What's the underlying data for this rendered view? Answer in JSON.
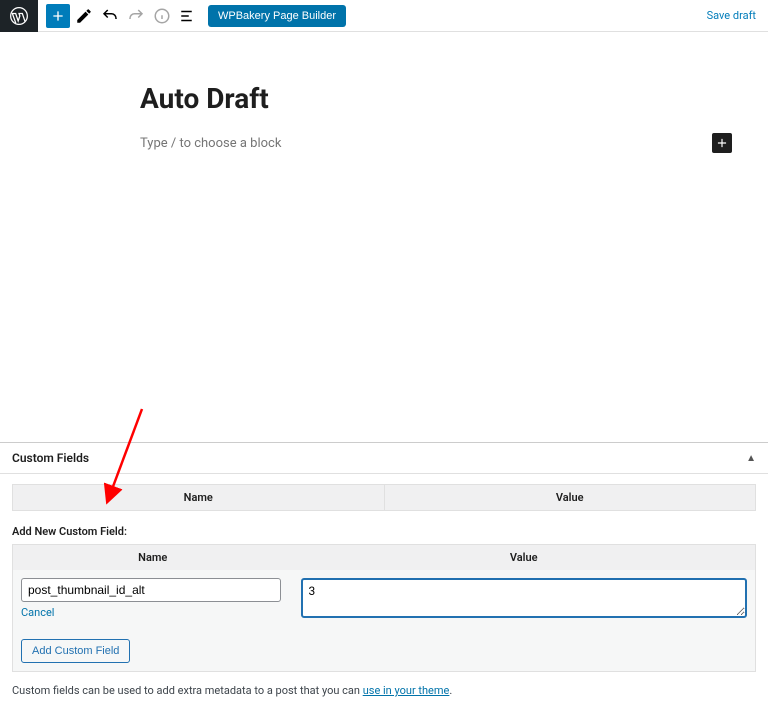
{
  "toolbar": {
    "wpbakery_label": "WPBakery Page Builder",
    "save_draft_label": "Save draft"
  },
  "editor": {
    "post_title": "Auto Draft",
    "block_placeholder": "Type / to choose a block"
  },
  "custom_fields": {
    "panel_title": "Custom Fields",
    "col_name": "Name",
    "col_value": "Value",
    "add_heading": "Add New Custom Field:",
    "name_input_value": "post_thumbnail_id_alt",
    "value_input_value": "3",
    "cancel_label": "Cancel",
    "add_button_label": "Add Custom Field",
    "footer_text": "Custom fields can be used to add extra metadata to a post that you can ",
    "footer_link": "use in your theme"
  }
}
